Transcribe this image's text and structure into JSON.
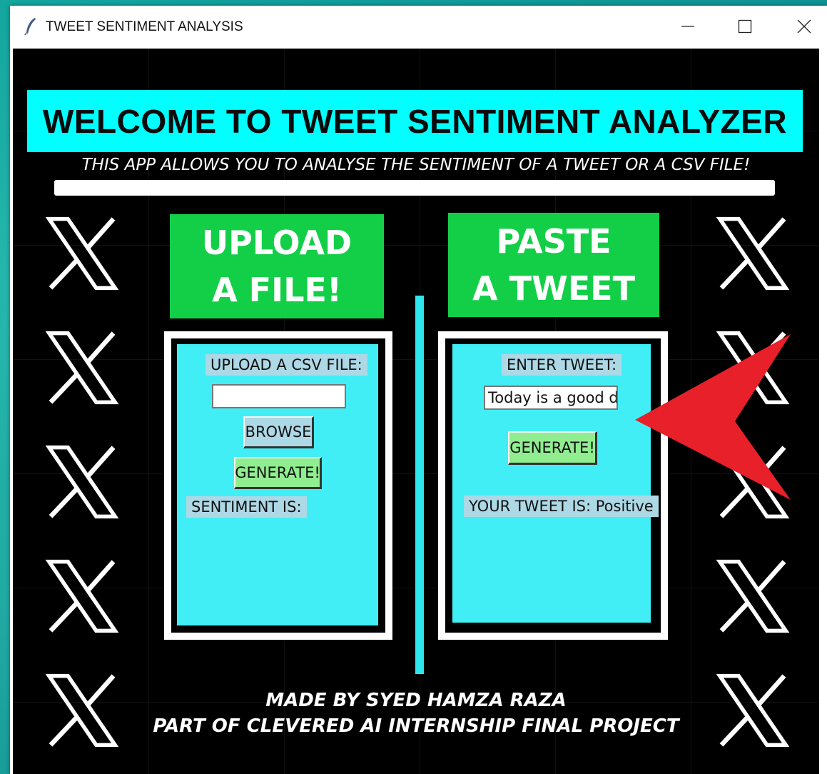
{
  "window": {
    "title": "TWEET SENTIMENT ANALYSIS",
    "controls": {
      "minimize": "minimize-icon",
      "maximize": "maximize-icon",
      "close": "close-icon"
    }
  },
  "app": {
    "banner": "WELCOME TO TWEET SENTIMENT ANALYZER",
    "subtitle": "THIS APP ALLOWS YOU TO ANALYSE THE SENTIMENT OF A TWEET OR A CSV FILE!",
    "upload_heading": {
      "line1": "UPLOAD",
      "line2": "A FILE!"
    },
    "paste_heading": {
      "line1": "PASTE",
      "line2": "A TWEET"
    },
    "upload_panel": {
      "label": "UPLOAD A CSV FILE:",
      "file_value": "",
      "browse_button": "BROWSE",
      "generate_button": "GENERATE!",
      "result_label": "SENTIMENT IS:"
    },
    "tweet_panel": {
      "label": "ENTER TWEET:",
      "tweet_value": "Today is a good day",
      "generate_button": "GENERATE!",
      "result_label": "YOUR TWEET IS: Positive"
    },
    "footer": {
      "line1": "MADE BY SYED HAMZA RAZA",
      "line2": "PART OF CLEVERED AI INTERNSHIP FINAL PROJECT"
    },
    "colors": {
      "banner": "#00ffff",
      "heading": "#13cf48",
      "panel": "#42eef5",
      "label": "#add8e6",
      "button_browse": "#add8e6",
      "button_generate": "#90ee90",
      "annotation_arrow": "#e8202a"
    },
    "decor_icons": "x-logo-icon"
  }
}
